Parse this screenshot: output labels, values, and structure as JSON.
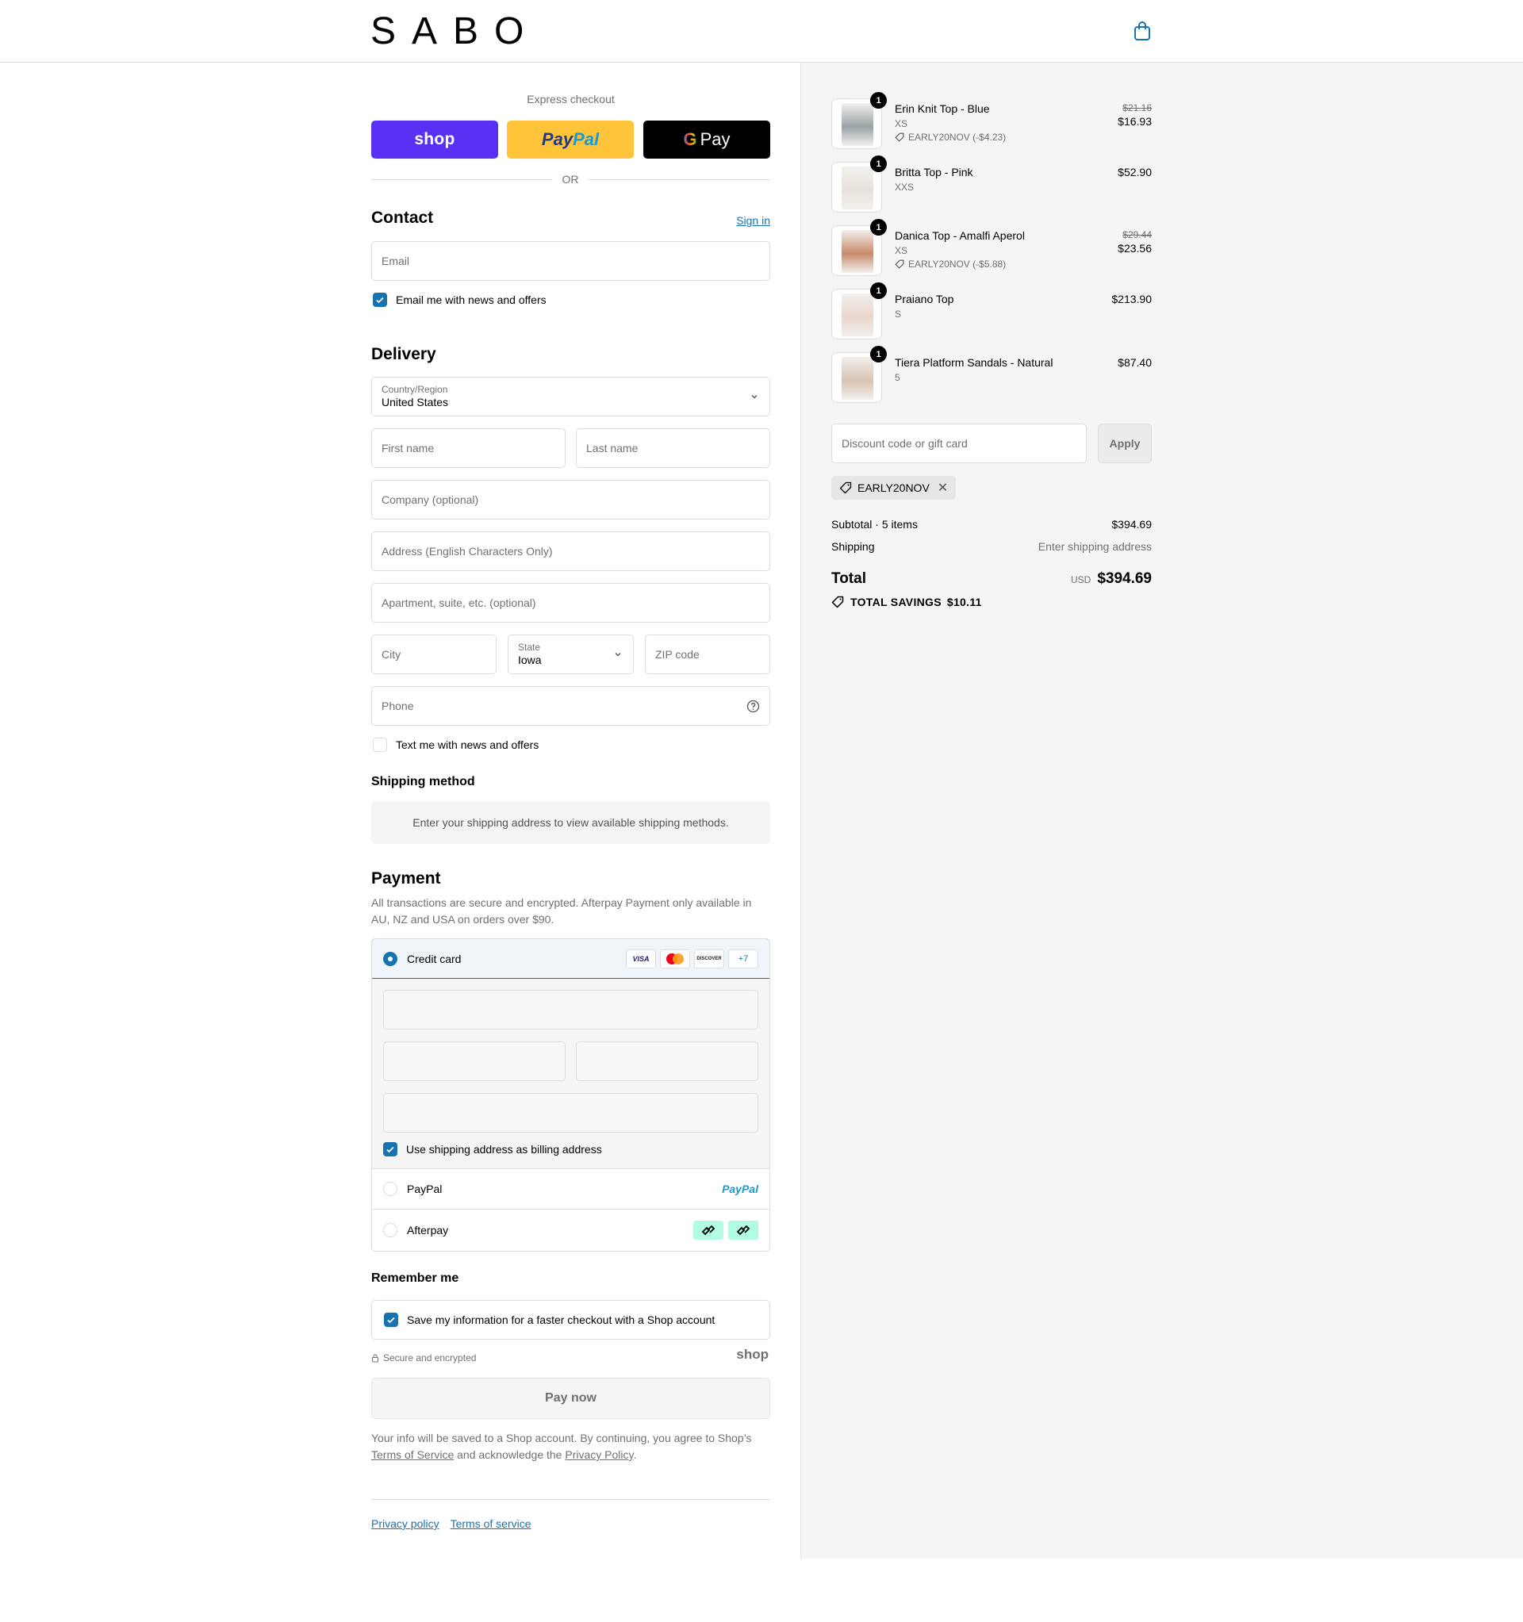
{
  "header": {
    "logo": "SABO",
    "cart_icon": "shopping-bag-icon"
  },
  "express": {
    "title": "Express checkout",
    "shop_label": "shop",
    "paypal_label_1": "Pay",
    "paypal_label_2": "Pal",
    "gpay_label": "Pay",
    "or_label": "OR"
  },
  "contact": {
    "heading": "Contact",
    "signin": "Sign in",
    "email_placeholder": "Email",
    "newsletter_label": "Email me with news and offers",
    "newsletter_checked": true
  },
  "delivery": {
    "heading": "Delivery",
    "country_label": "Country/Region",
    "country_value": "United States",
    "first_name": "First name",
    "last_name": "Last name",
    "company": "Company (optional)",
    "address": "Address (English Characters Only)",
    "apartment": "Apartment, suite, etc. (optional)",
    "city": "City",
    "state_label": "State",
    "state_value": "Iowa",
    "zip": "ZIP code",
    "phone": "Phone",
    "sms_label": "Text me with news and offers",
    "sms_checked": false
  },
  "shipping_method": {
    "heading": "Shipping method",
    "info": "Enter your shipping address to view available shipping methods."
  },
  "payment": {
    "heading": "Payment",
    "note": "All transactions are secure and encrypted. Afterpay Payment only available in AU, NZ and USA on orders over $90.",
    "credit_card_label": "Credit card",
    "card_brands": [
      "VISA",
      "",
      "DISCOVER",
      "+7"
    ],
    "billing_label": "Use shipping address as billing address",
    "billing_checked": true,
    "paypal_label": "PayPal",
    "paypal_brand": "PayPal",
    "afterpay_label": "Afterpay"
  },
  "remember": {
    "heading": "Remember me",
    "save_label": "Save my information for a faster checkout with a Shop account",
    "save_checked": true,
    "secure_label": "Secure and encrypted",
    "shop_mark": "shop"
  },
  "pay_now": "Pay now",
  "legal": {
    "text_1": "Your info will be saved to a Shop account. By continuing, you agree to Shop’s ",
    "tos": "Terms of Service",
    "text_2": " and acknowledge the ",
    "privacy": "Privacy Policy",
    "text_3": "."
  },
  "footer": {
    "privacy": "Privacy policy",
    "terms": "Terms of service"
  },
  "summary": {
    "items": [
      {
        "name": "Erin Knit Top - Blue",
        "variant": "XS",
        "discount": "EARLY20NOV (-$4.23)",
        "old_price": "$21.16",
        "price": "$16.93",
        "qty": "1",
        "thumb_color": "#9aa3a6"
      },
      {
        "name": "Britta Top - Pink",
        "variant": "XXS",
        "discount": "",
        "old_price": "",
        "price": "$52.90",
        "qty": "1",
        "thumb_color": "#e8e2dc"
      },
      {
        "name": "Danica Top - Amalfi Aperol",
        "variant": "XS",
        "discount": "EARLY20NOV (-$5.88)",
        "old_price": "$29.44",
        "price": "$23.56",
        "qty": "1",
        "thumb_color": "#c98a6a"
      },
      {
        "name": "Praiano Top",
        "variant": "S",
        "discount": "",
        "old_price": "",
        "price": "$213.90",
        "qty": "1",
        "thumb_color": "#e9d6cc"
      },
      {
        "name": "Tiera Platform Sandals - Natural",
        "variant": "5",
        "discount": "",
        "old_price": "",
        "price": "$87.40",
        "qty": "1",
        "thumb_color": "#d8c3b3"
      }
    ],
    "discount_placeholder": "Discount code or gift card",
    "apply": "Apply",
    "applied_code": "EARLY20NOV",
    "subtotal_label": "Subtotal · 5 items",
    "subtotal": "$394.69",
    "shipping_label": "Shipping",
    "shipping_value": "Enter shipping address",
    "total_label": "Total",
    "currency": "USD",
    "total": "$394.69",
    "savings_label": "TOTAL SAVINGS",
    "savings": "$10.11"
  },
  "colors": {
    "accent": "#1773b0",
    "shop": "#5a31f4",
    "paypal": "#ffc439",
    "afterpay": "#b2fce4"
  }
}
